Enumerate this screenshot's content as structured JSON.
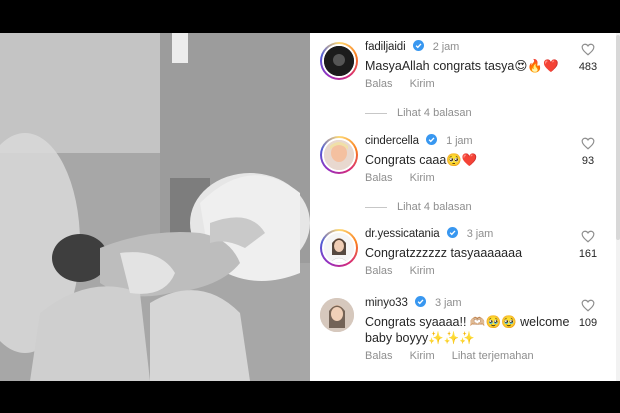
{
  "comments": [
    {
      "username": "fadiljaidi",
      "time": "2 jam",
      "text": "MasyaAllah congrats tasya😍🔥❤️",
      "likes": "483",
      "reply_label": "Balas",
      "send_label": "Kirim",
      "view_replies": "Lihat 4 balasan"
    },
    {
      "username": "cindercella",
      "time": "1 jam",
      "text": "Congrats caaa🥺❤️",
      "likes": "93",
      "reply_label": "Balas",
      "send_label": "Kirim",
      "view_replies": "Lihat 4 balasan"
    },
    {
      "username": "dr.yessicatania",
      "time": "3 jam",
      "text": "Congratzzzzzz tasyaaaaaaa",
      "likes": "161",
      "reply_label": "Balas",
      "send_label": "Kirim"
    },
    {
      "username": "minyo33",
      "time": "3 jam",
      "text": "Congrats syaaaa!! 🫶🏼🥹🥹 welcome baby boyyy✨✨✨",
      "likes": "109",
      "reply_label": "Balas",
      "send_label": "Kirim",
      "translate_label": "Lihat terjemahan"
    }
  ],
  "icons": {
    "verified": "verified-badge-icon",
    "like": "heart-outline-icon"
  },
  "colors": {
    "verified_blue": "#3897f0",
    "muted": "#8e8e8e",
    "text": "#262626"
  }
}
